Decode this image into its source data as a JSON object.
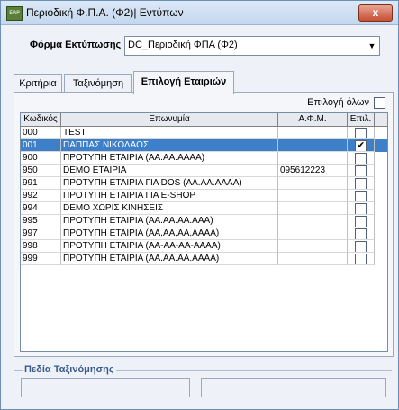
{
  "window": {
    "title": "Περιοδική Φ.Π.Α. (Φ2)| Εντύπων",
    "icon": "app-icon",
    "close_symbol": "x"
  },
  "form": {
    "label": "Φόρμα Εκτύπωσης",
    "value": "DC_Περιοδική ΦΠΑ (Φ2)"
  },
  "tabs": [
    {
      "label": "Κριτήρια",
      "active": false
    },
    {
      "label": "Ταξινόμηση",
      "active": false
    },
    {
      "label": "Επιλογή Εταιριών",
      "active": true
    }
  ],
  "select_all": {
    "label": "Επιλογή όλων",
    "checked": false
  },
  "grid": {
    "columns": [
      "Κωδικός",
      "Επωνυμία",
      "Α.Φ.Μ.",
      "Επιλ."
    ],
    "rows": [
      {
        "code": "000",
        "name": "TEST",
        "afm": "",
        "checked": false,
        "selected": false
      },
      {
        "code": "001",
        "name": "ΠΑΠΠΑΣ ΝΙΚΟΛΑΟΣ",
        "afm": "",
        "checked": true,
        "selected": true
      },
      {
        "code": "900",
        "name": "ΠΡΟΤΥΠΗ  ΕΤΑΙΡΙΑ (ΑΑ.ΑΑ.ΑΑΑΑ)",
        "afm": "",
        "checked": false,
        "selected": false
      },
      {
        "code": "950",
        "name": "DEMO ΕΤΑΙΡΙΑ",
        "afm": "095612223",
        "checked": false,
        "selected": false
      },
      {
        "code": "991",
        "name": "ΠΡΟΤΥΠΗ ΕΤΑΙΡΙΑ ΓΙΑ DOS (ΑΑ.ΑΑ.ΑΑΑΑ)",
        "afm": "",
        "checked": false,
        "selected": false
      },
      {
        "code": "992",
        "name": "ΠΡΟΤΥΠΗ ΕΤΑΙΡΙΑ ΓΙΑ E-SHOP",
        "afm": "",
        "checked": false,
        "selected": false
      },
      {
        "code": "994",
        "name": "DEMO ΧΩΡΙΣ ΚΙΝΗΣΕΙΣ",
        "afm": "",
        "checked": false,
        "selected": false
      },
      {
        "code": "995",
        "name": "ΠΡΟΤΥΠΗ ΕΤΑΙΡΙΑ (ΑΑ.ΑΑ.ΑΑ.ΑΑΑ)",
        "afm": "",
        "checked": false,
        "selected": false
      },
      {
        "code": "997",
        "name": "ΠΡΟΤΥΠΗ ΕΤΑΙΡΙΑ (ΑΑ,ΑΑ,ΑΑ,ΑΑΑΑ)",
        "afm": "",
        "checked": false,
        "selected": false
      },
      {
        "code": "998",
        "name": "ΠΡΟΤΥΠΗ ΕΤΑΙΡΙΑ (ΑΑ-ΑΑ-ΑΑ-ΑΑΑΑ)",
        "afm": "",
        "checked": false,
        "selected": false
      },
      {
        "code": "999",
        "name": "ΠΡΟΤΥΠΗ ΕΤΑΙΡΙΑ (ΑΑ.ΑΑ.ΑΑ.ΑΑΑΑ)",
        "afm": "",
        "checked": false,
        "selected": false
      }
    ]
  },
  "sort_fields": {
    "label": "Πεδία Ταξινόμησης"
  },
  "colors": {
    "selection": "#3d7fc9",
    "group_label": "#3a5b8a",
    "close_button": "#c74f34"
  }
}
